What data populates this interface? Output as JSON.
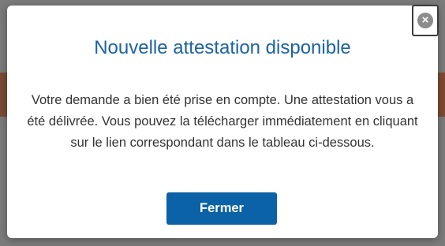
{
  "modal": {
    "title": "Nouvelle attestation disponible",
    "message": "Votre demande a bien été prise en compte. Une attestation vous a été délivrée. Vous pouvez la télécharger immédiatement en cliquant sur le lien correspondant dans le tableau ci-dessous.",
    "close_icon": "close-icon",
    "close_button_label": "Fermer"
  },
  "colors": {
    "title": "#1b63a5",
    "primary_button": "#0b62a6",
    "overlay": "#7b7b7b",
    "band": "#7c4a33"
  }
}
